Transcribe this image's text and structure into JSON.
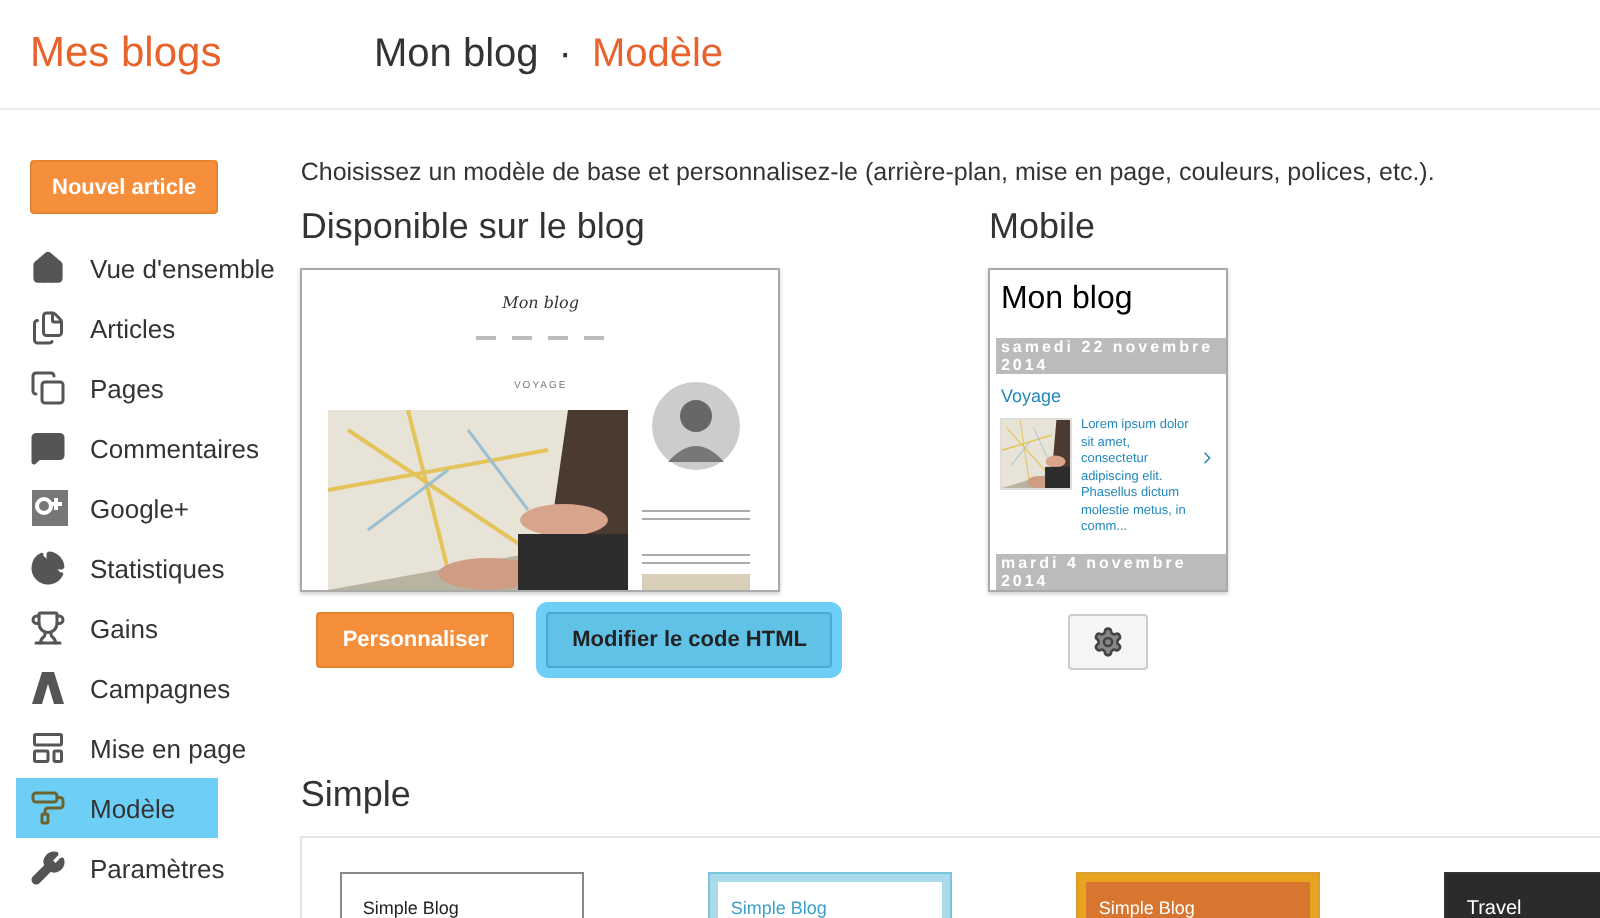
{
  "header": {
    "brand": "Mes blogs",
    "blog_name": "Mon blog",
    "separator": "·",
    "page": "Modèle"
  },
  "sidebar": {
    "new_post": "Nouvel article",
    "items": [
      {
        "label": "Vue d'ensemble",
        "selected": false
      },
      {
        "label": "Articles",
        "selected": false
      },
      {
        "label": "Pages",
        "selected": false
      },
      {
        "label": "Commentaires",
        "selected": false
      },
      {
        "label": "Google+",
        "selected": false
      },
      {
        "label": "Statistiques",
        "selected": false
      },
      {
        "label": "Gains",
        "selected": false
      },
      {
        "label": "Campagnes",
        "selected": false
      },
      {
        "label": "Mise en page",
        "selected": false
      },
      {
        "label": "Modèle",
        "selected": true
      },
      {
        "label": "Paramètres",
        "selected": false
      }
    ]
  },
  "intro": "Choisissez un modèle de base et personnalisez-le (arrière-plan, mise en page, couleurs, polices, etc.).",
  "live": {
    "heading": "Disponible sur le blog",
    "preview": {
      "title": "Mon blog",
      "post_title": "VOYAGE"
    },
    "buttons": [
      {
        "label": "Personnaliser",
        "kind": "primary",
        "selected": false
      },
      {
        "label": "Modifier le code HTML",
        "kind": "secondary",
        "selected": true
      }
    ]
  },
  "mobile": {
    "heading": "Mobile",
    "preview": {
      "title": "Mon blog",
      "date": "samedi 22 novembre 2014",
      "post_title": "Voyage",
      "excerpt": "Lorem ipsum dolor sit amet, consectetur adipiscing elit. Phasellus dictum molestie metus, in comm...",
      "next_date": "mardi 4 novembre 2014"
    }
  },
  "simple": {
    "heading": "Simple",
    "templates": [
      {
        "title": "Simple Blog",
        "kind": "white"
      },
      {
        "title": "Simple Blog",
        "kind": "blue"
      },
      {
        "title": "Simple Blog",
        "kind": "orange"
      },
      {
        "title": "Travel",
        "kind": "dark"
      }
    ]
  }
}
